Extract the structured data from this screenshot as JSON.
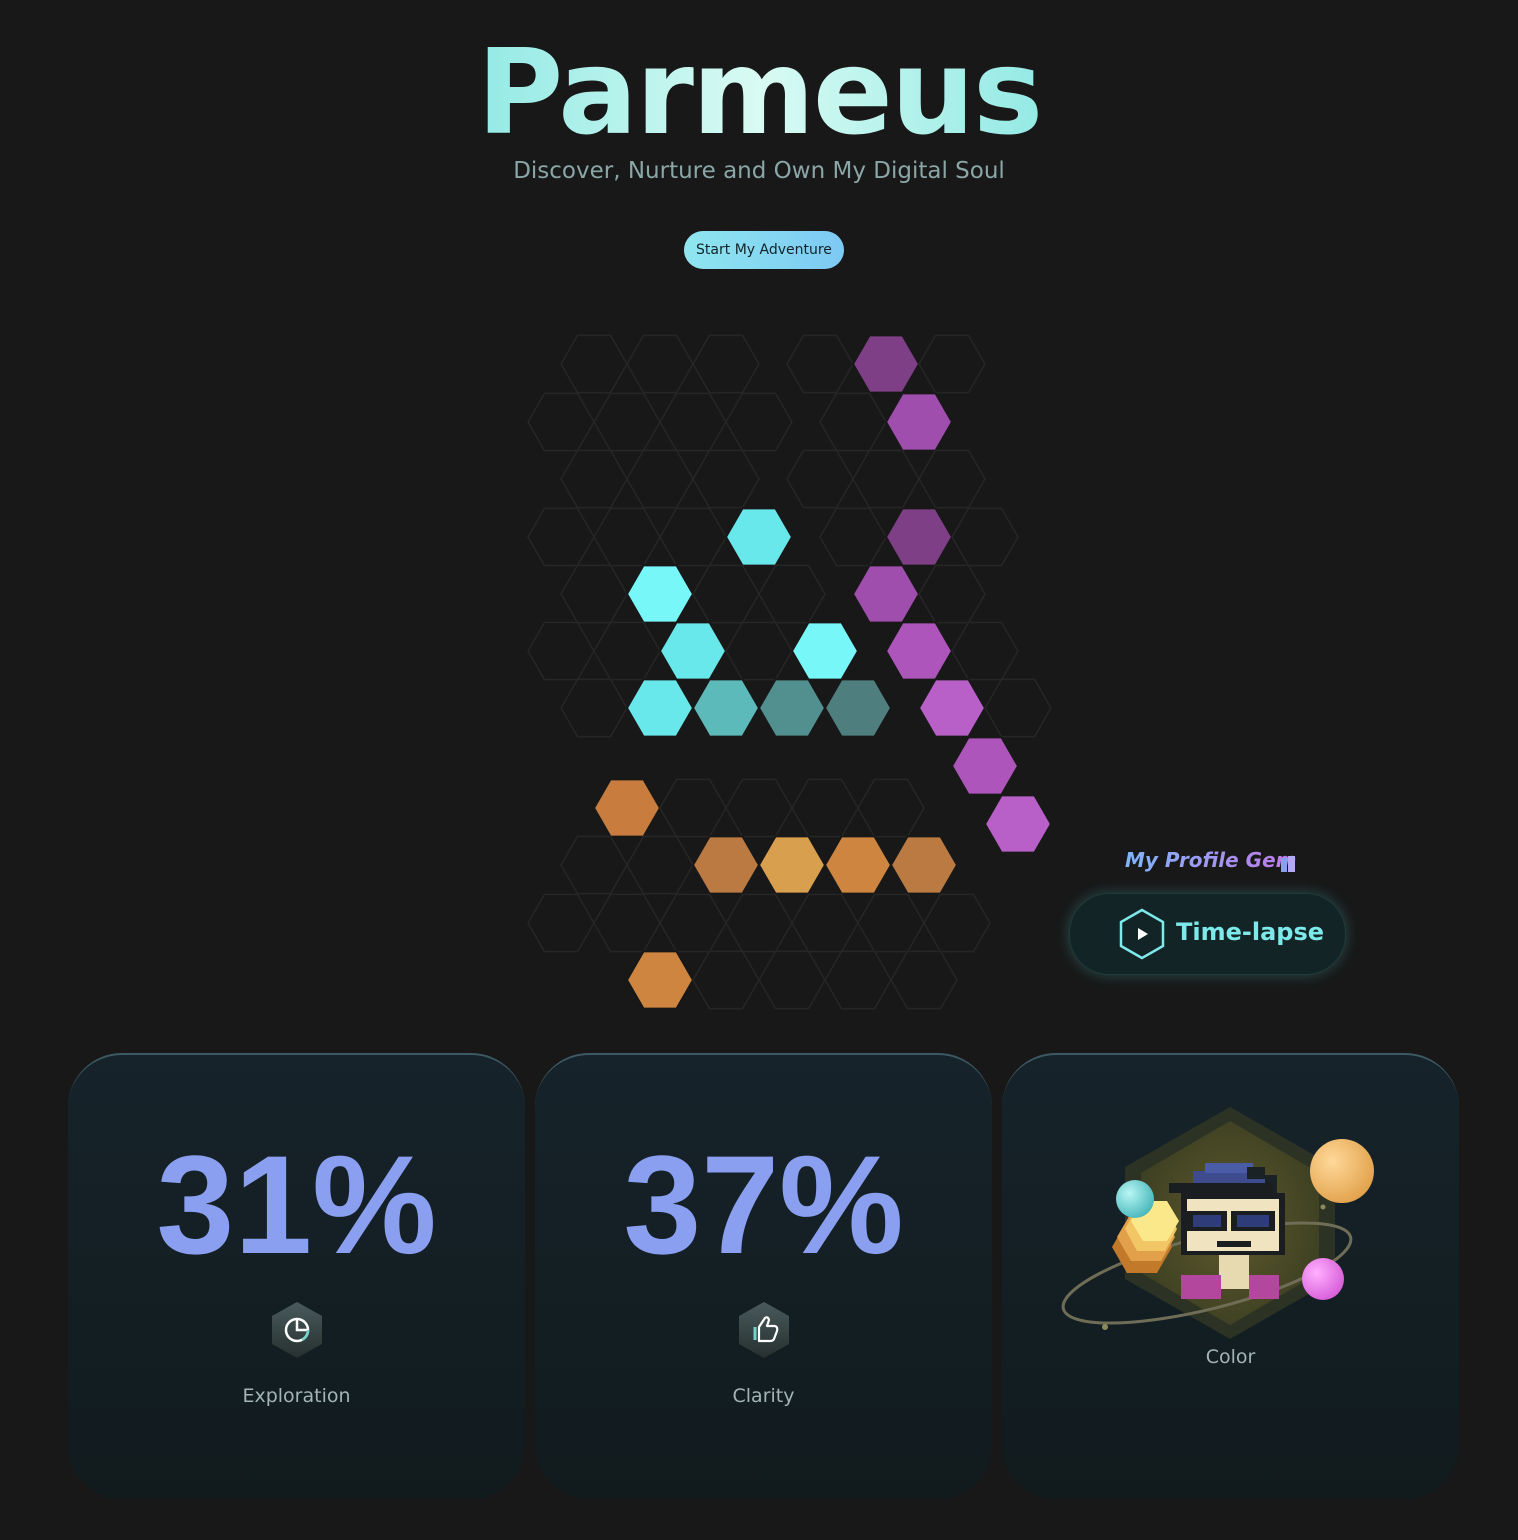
{
  "header": {
    "title": "Parmeus",
    "subtitle": "Discover, Nurture and Own My Digital Soul",
    "cta_label": "Start My Adventure"
  },
  "profile_gem": {
    "label": "My Profile Gem",
    "timelapse_label": "Time-lapse"
  },
  "stats": [
    {
      "value": "31%",
      "label": "Exploration",
      "icon": "pie-chart-icon"
    },
    {
      "value": "37%",
      "label": "Clarity",
      "icon": "thumbs-up-icon"
    }
  ],
  "color_card": {
    "label": "Color"
  },
  "palette": {
    "background": "#181818",
    "empty_cell_stroke": "#262626",
    "purple": [
      "#7e3f86",
      "#a04ead",
      "#ad55bb",
      "#b860c8"
    ],
    "cyan": [
      "#78f7f9",
      "#68e8ea",
      "#5dbabb",
      "#528f8f",
      "#4e7e7d"
    ],
    "orange": [
      "#c87c3e",
      "#d8a04e",
      "#ba7a42",
      "#cd8540"
    ],
    "accent_text": "#8a9ff0"
  }
}
